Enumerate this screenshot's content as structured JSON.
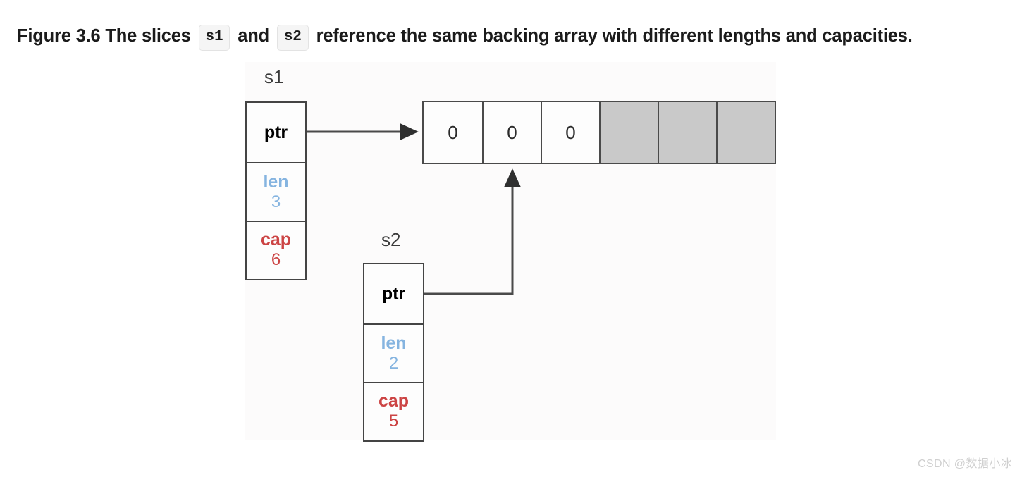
{
  "caption": {
    "prefix": "Figure 3.6 The slices",
    "code1": "s1",
    "middle": "and",
    "code2": "s2",
    "suffix": "reference the same backing array with different lengths and capacities."
  },
  "colors": {
    "ptr": "#000000",
    "len": "#85b4e0",
    "cap": "#cc4444",
    "cell_border": "#444444",
    "array_empty_fill": "#c9c9c9",
    "panel_bg": "#fcfbfb",
    "badge_bg": "#f5f5f5"
  },
  "structs": [
    {
      "label": "s1",
      "fields": [
        {
          "name": "ptr",
          "value": ""
        },
        {
          "name": "len",
          "value": "3"
        },
        {
          "name": "cap",
          "value": "6"
        }
      ]
    },
    {
      "label": "s2",
      "fields": [
        {
          "name": "ptr",
          "value": ""
        },
        {
          "name": "len",
          "value": "2"
        },
        {
          "name": "cap",
          "value": "5"
        }
      ]
    }
  ],
  "backing_array": {
    "cells": [
      {
        "value": "0",
        "state": "filled"
      },
      {
        "value": "0",
        "state": "filled"
      },
      {
        "value": "0",
        "state": "filled"
      },
      {
        "value": "",
        "state": "empty"
      },
      {
        "value": "",
        "state": "empty"
      },
      {
        "value": "",
        "state": "empty"
      }
    ]
  },
  "connectors": [
    {
      "from": "s1-ptr",
      "to": "array-cell-0",
      "direction": "right"
    },
    {
      "from": "s2-ptr",
      "to": "array-cell-1",
      "direction": "right-then-up"
    }
  ],
  "watermark": "CSDN @数据小冰"
}
